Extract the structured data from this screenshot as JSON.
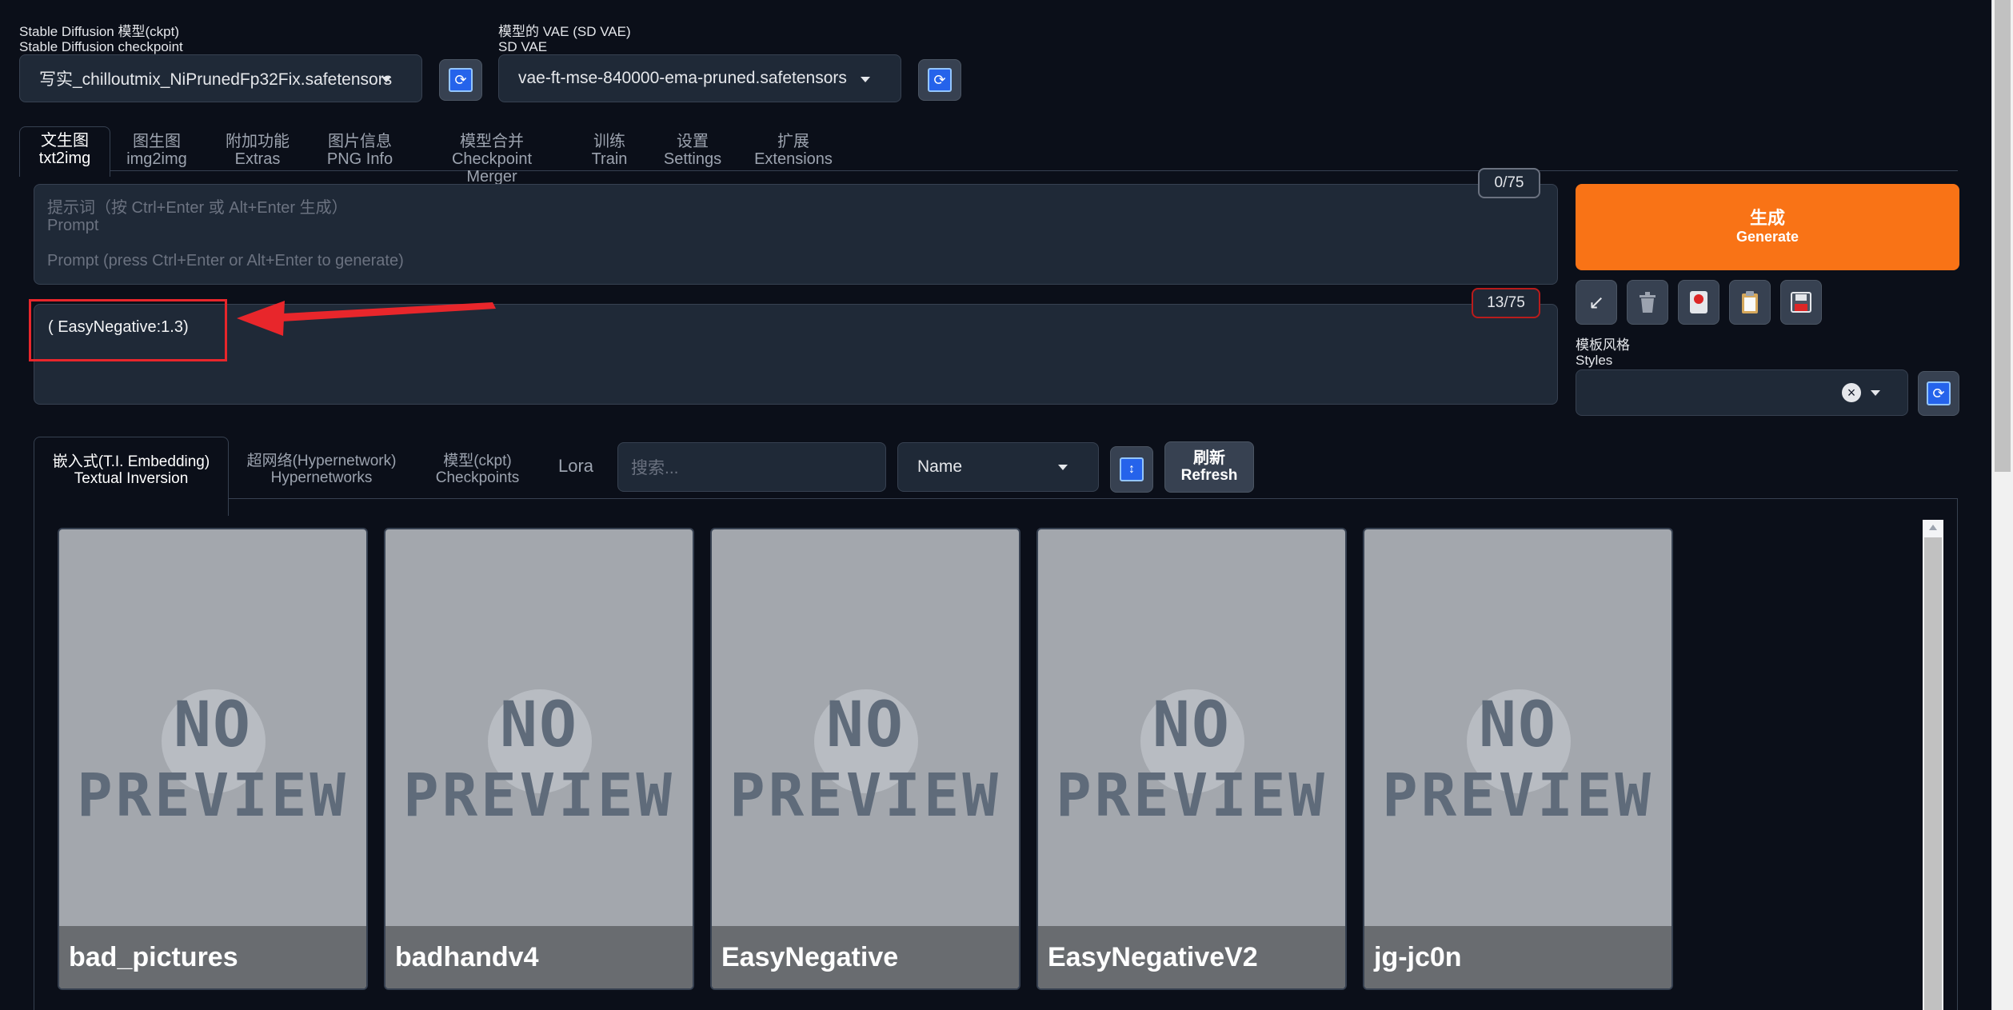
{
  "checkpoint": {
    "label_zh": "Stable Diffusion 模型(ckpt)",
    "label_en": "Stable Diffusion checkpoint",
    "value": "写实_chilloutmix_NiPrunedFp32Fix.safetensors"
  },
  "vae": {
    "label_zh": "模型的 VAE (SD VAE)",
    "label_en": "SD VAE",
    "value": "vae-ft-mse-840000-ema-pruned.safetensors"
  },
  "tabs": [
    {
      "zh": "文生图",
      "en": "txt2img"
    },
    {
      "zh": "图生图",
      "en": "img2img"
    },
    {
      "zh": "附加功能",
      "en": "Extras"
    },
    {
      "zh": "图片信息",
      "en": "PNG Info"
    },
    {
      "zh": "模型合并",
      "en": "Checkpoint Merger"
    },
    {
      "zh": "训练",
      "en": "Train"
    },
    {
      "zh": "设置",
      "en": "Settings"
    },
    {
      "zh": "扩展",
      "en": "Extensions"
    }
  ],
  "prompt": {
    "hint_zh": "提示词（按 Ctrl+Enter 或 Alt+Enter 生成）",
    "hint_en": "Prompt",
    "placeholder": "Prompt (press Ctrl+Enter or Alt+Enter to generate)",
    "counter": "0/75"
  },
  "negative": {
    "value": "( EasyNegative:1.3)",
    "counter": "13/75"
  },
  "generate": {
    "zh": "生成",
    "en": "Generate"
  },
  "styles": {
    "zh": "模板风格",
    "en": "Styles"
  },
  "colors": {
    "accent": "#f97316",
    "annotation": "#e8262b",
    "refresh": "#2563eb"
  },
  "extra_tabs": [
    {
      "zh": "嵌入式(T.I. Embedding)",
      "en": "Textual Inversion"
    },
    {
      "zh": "超网络(Hypernetwork)",
      "en": "Hypernetworks"
    },
    {
      "zh": "模型(ckpt)",
      "en": "Checkpoints"
    },
    {
      "zh": "",
      "en": "Lora"
    }
  ],
  "search": {
    "placeholder": "搜索..."
  },
  "sort": {
    "value": "Name"
  },
  "refresh": {
    "zh": "刷新",
    "en": "Refresh"
  },
  "cards": [
    {
      "name": "bad_pictures",
      "preview_top": "NO",
      "preview_bottom": "PREVIEW"
    },
    {
      "name": "badhandv4",
      "preview_top": "NO",
      "preview_bottom": "PREVIEW"
    },
    {
      "name": "EasyNegative",
      "preview_top": "NO",
      "preview_bottom": "PREVIEW"
    },
    {
      "name": "EasyNegativeV2",
      "preview_top": "NO",
      "preview_bottom": "PREVIEW"
    },
    {
      "name": "jg-jc0n",
      "preview_top": "NO",
      "preview_bottom": "PREVIEW"
    }
  ]
}
